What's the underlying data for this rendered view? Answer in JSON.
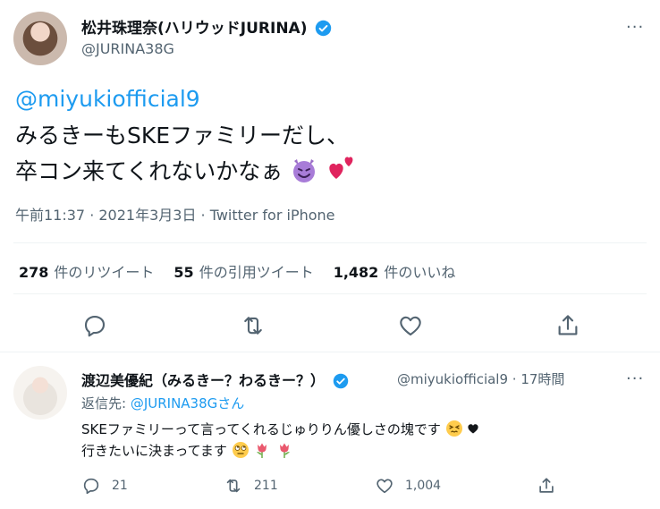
{
  "tweet": {
    "author_name": "松井珠理奈(ハリウッドJURINA)",
    "author_handle": "@JURINA38G",
    "mention": "@miyukiofficial9",
    "text_line1": "みるきーもSKEファミリーだし、",
    "text_line2": "卒コン来てくれないかなぁ",
    "meta": "午前11:37 · 2021年3月3日 · Twitter for iPhone",
    "stats": [
      {
        "num": "278",
        "label": "件のリツイート"
      },
      {
        "num": "55",
        "label": "件の引用ツイート"
      },
      {
        "num": "1,482",
        "label": "件のいいね"
      }
    ],
    "more": "···"
  },
  "reply": {
    "author_name": "渡辺美優紀（みるきー？わるきー？）",
    "author_handle": "@miyukiofficial9 · 17時間",
    "reply_prefix": "返信先: ",
    "reply_to": "@JURINA38Gさん",
    "text_line1": "SKEファミリーって言ってくれるじゅりりん優しさの塊です",
    "text_line2": "行きたいに決まってます",
    "counts": {
      "replies": "21",
      "retweets": "211",
      "likes": "1,004"
    },
    "more": "···"
  },
  "colors": {
    "accent": "#1d9bf0",
    "muted": "#536471",
    "text": "#0f1419",
    "divider": "#eff3f4"
  },
  "icons": [
    "reply-icon",
    "retweet-icon",
    "like-icon",
    "share-icon",
    "verified-icon",
    "more-icon"
  ]
}
